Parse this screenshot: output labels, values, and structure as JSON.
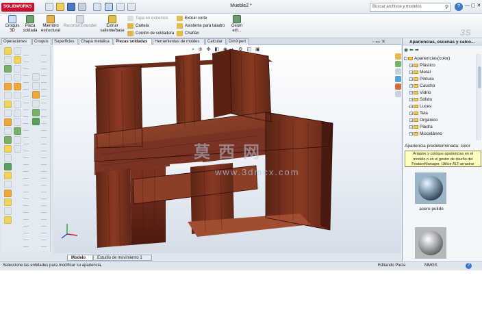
{
  "app": {
    "logo": "SOLIDWORKS",
    "document_title": "Mueble2 *",
    "search_placeholder": "Buscar archivos y modelos",
    "help": "?",
    "window_controls": "— ▢ ✕"
  },
  "ribbon": {
    "big_buttons": [
      {
        "label": "Croquis\n3D",
        "disabled": false
      },
      {
        "label": "Pieza\nsoldada",
        "disabled": false
      },
      {
        "label": "Miembro\nestructural",
        "disabled": false
      },
      {
        "label": "Recortar/Extender",
        "disabled": true
      },
      {
        "label": "Extruir\nsaliente/base",
        "disabled": false
      }
    ],
    "small_buttons_col1": [
      {
        "label": "Tapa en extremos",
        "disabled": true
      },
      {
        "label": "Cartela",
        "disabled": false
      },
      {
        "label": "Cordón de soldadura",
        "disabled": false
      }
    ],
    "small_buttons_col2": [
      {
        "label": "Extruir corte",
        "disabled": false
      },
      {
        "label": "Asistente para taladro",
        "disabled": false
      },
      {
        "label": "Chaflán",
        "disabled": false
      }
    ],
    "geom_button": "Geom\netri..."
  },
  "tabs": [
    "Operaciones",
    "Croquis",
    "Superficies",
    "Chapa metálica",
    "Piezas soldadas",
    "Herramientas de moldes",
    "Calcular",
    "DimXpert"
  ],
  "active_tab": "Piezas soldadas",
  "model_tabs": [
    "Modelo",
    "Estudio de movimiento 1"
  ],
  "active_model_tab": "Modelo",
  "status": {
    "message": "Seleccione las entidades para modificar su apariencia.",
    "mode": "Editando Pieza",
    "units": "MMGS",
    "help": "?"
  },
  "watermark": {
    "chars": "莫西网",
    "url": "www.3dmcx.com"
  },
  "task_pane": {
    "title": "Apariencias, escenas y calco...",
    "root": "Apariencias(color)",
    "items": [
      "Plástico",
      "Metal",
      "Pintura",
      "Caucho",
      "Vidrio",
      "Sólido",
      "Luces",
      "Tela",
      "Orgánico",
      "Piedra",
      "Misceláneo"
    ],
    "default_appearance": "Apariencia predeterminada: color",
    "tooltip": "Arrastre y coloque apariencias en el modelo o en el gestor de diseño del FeatureManager. Utilice ALT-arrastrar",
    "swatches": [
      "acero pulido",
      ""
    ]
  },
  "colors": {
    "wood_dark": "#4a1a10",
    "wood_mid": "#7a3422",
    "wood_light": "#9a4a30",
    "accent_blue": "#3d78c6",
    "tooltip_bg": "#ffffc2"
  }
}
